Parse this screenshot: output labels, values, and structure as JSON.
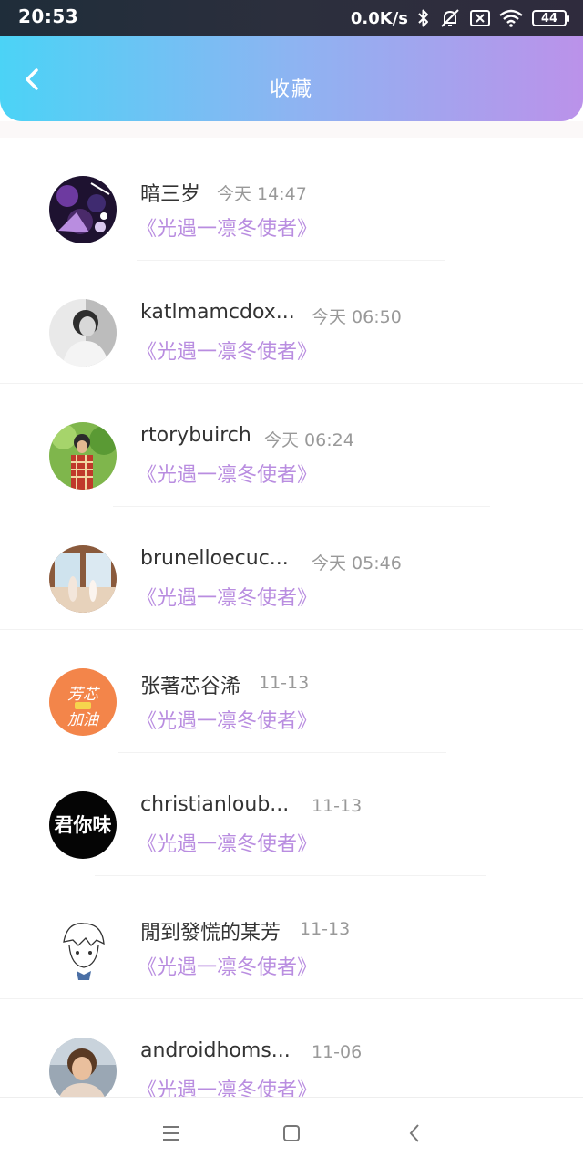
{
  "status_bar": {
    "time": "20:53",
    "net_speed": "0.0K/s",
    "battery": "44"
  },
  "header": {
    "title": "收藏"
  },
  "favorites": [
    {
      "name": "暗三岁",
      "time": "今天 14:47",
      "title": "《光遇一凛冬使者》"
    },
    {
      "name": "katlmamcdox...",
      "time": "今天 06:50",
      "title": "《光遇一凛冬使者》"
    },
    {
      "name": "rtorybuirch",
      "time": "今天 06:24",
      "title": "《光遇一凛冬使者》"
    },
    {
      "name": "brunelloecuc...",
      "time": "今天 05:46",
      "title": "《光遇一凛冬使者》"
    },
    {
      "name": "张著芯谷浠",
      "time": "11-13",
      "title": "《光遇一凛冬使者》"
    },
    {
      "name": "christianloub...",
      "time": "11-13",
      "title": "《光遇一凛冬使者》"
    },
    {
      "name": "閒到發慌的某芳",
      "time": "11-13",
      "title": "《光遇一凛冬使者》"
    },
    {
      "name": "androidhoms...",
      "time": "11-06",
      "title": "《光遇一凛冬使者》"
    }
  ],
  "avatar_texts": {
    "orange_badge": "芳芯 加油",
    "black_badge": "君你味"
  },
  "colors": {
    "header_gradient_start": "#4bd3f6",
    "header_gradient_end": "#bb92ea",
    "post_title": "#b98de0",
    "time_text": "#999999"
  }
}
